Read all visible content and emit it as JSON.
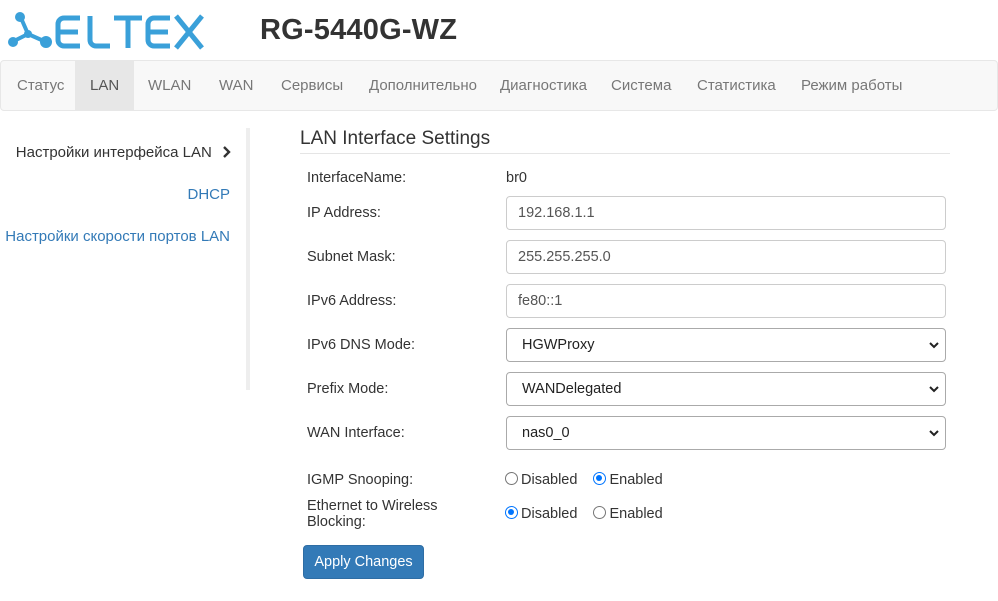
{
  "brand": {
    "logo_text": "ELTEX",
    "logo_color": "#3aa0d9",
    "model": "RG-5440G-WZ"
  },
  "nav": {
    "items": [
      {
        "label": "Статус"
      },
      {
        "label": "LAN",
        "active": true
      },
      {
        "label": "WLAN"
      },
      {
        "label": "WAN"
      },
      {
        "label": "Сервисы"
      },
      {
        "label": "Дополнительно"
      },
      {
        "label": "Диагностика"
      },
      {
        "label": "Система"
      },
      {
        "label": "Статистика"
      },
      {
        "label": "Режим работы"
      }
    ]
  },
  "sidebar": {
    "items": [
      {
        "label": "Настройки интерфейса LAN",
        "current": true
      },
      {
        "label": "DHCP"
      },
      {
        "label": "Настройки скорости портов LAN"
      }
    ]
  },
  "form": {
    "title": "LAN Interface Settings",
    "interface_name": {
      "label": "InterfaceName:",
      "value": "br0"
    },
    "ip_address": {
      "label": "IP Address:",
      "value": "192.168.1.1"
    },
    "subnet_mask": {
      "label": "Subnet Mask:",
      "value": "255.255.255.0"
    },
    "ipv6_address": {
      "label": "IPv6 Address:",
      "value": "fe80::1"
    },
    "ipv6_dns_mode": {
      "label": "IPv6 DNS Mode:",
      "value": "HGWProxy"
    },
    "prefix_mode": {
      "label": "Prefix Mode:",
      "value": "WANDelegated"
    },
    "wan_interface": {
      "label": "WAN Interface:",
      "value": "nas0_0"
    },
    "igmp_snooping": {
      "label": "IGMP Snooping:",
      "options": [
        "Disabled",
        "Enabled"
      ],
      "selected": "Enabled"
    },
    "eth_wireless_blocking": {
      "label_line1": "Ethernet to Wireless",
      "label_line2": "Blocking:",
      "options": [
        "Disabled",
        "Enabled"
      ],
      "selected": "Disabled"
    },
    "apply_label": "Apply Changes"
  },
  "colors": {
    "primary_button": "#337ab7",
    "link": "#337ab7",
    "radio_checked": "#0075ff"
  }
}
